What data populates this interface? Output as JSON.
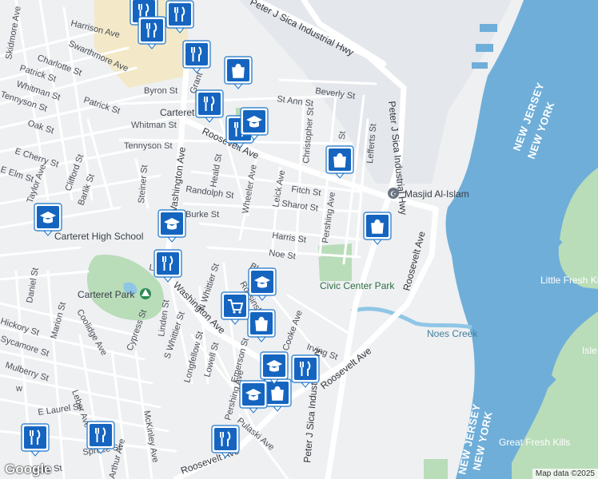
{
  "attribution": "Map data ©2025",
  "logo_text": "Google",
  "colors": {
    "water": "#6faed8",
    "park": "#b9dcb9",
    "road": "#ffffff",
    "land": "#eef0f2",
    "industrial": "#e4e7ec",
    "pin_blue": "#1565c0"
  },
  "places": {
    "city": "Carteret",
    "mosque": "Masjid Al-Islam",
    "high_school": "Carteret High School",
    "park": "Carteret Park",
    "civic_park": "Civic Center Park",
    "creek": "Noes Creek",
    "little_fresh_kills": "Little Fresh Kills",
    "isle_meadow": "Isle Meadow",
    "great_fresh_kills": "Great Fresh Kills"
  },
  "borders": {
    "nj": "NEW JERSEY",
    "ny": "NEW YORK"
  },
  "highways": {
    "sica_top": "Peter J Sica Industrial Hwy",
    "sica_vertical": "Peter J Sica Industrial Hwy",
    "sica_bottom": "Peter J Sica Industrial Hwy",
    "roosevelt_main": "Roosevelt Ave",
    "roosevelt_east": "Roosevelt Ave",
    "roosevelt_lower": "Roosevelt Ave",
    "roosevelt_bottom": "Roosevelt Ave",
    "washington": "Washington Ave",
    "washington_lower": "Washington Ave"
  },
  "streets": {
    "harrison": "Harrison Ave",
    "swarthmore": "Swarthmore Ave",
    "skidmore": "Skidmore Ave",
    "charlotte": "Charlotte St",
    "patrick": "Patrick St",
    "whitman": "Whitman St",
    "tennyson": "Tennyson St",
    "patrick2": "Patrick St",
    "byron": "Byron St",
    "oak": "Oak St",
    "grant": "Grant",
    "whitman2": "Whitman St",
    "tennyson2": "Tennyson St",
    "e_cherry": "E Cherry St",
    "e_elm": "E Elm St",
    "taylor": "Taylor Ave",
    "clifford": "Clifford St",
    "barlik": "Barlik St",
    "steiner": "Steiner St",
    "heald": "Heald St",
    "randolph": "Randolph St",
    "burke": "Burke St",
    "wheeler": "Wheeler Ave",
    "leick": "Leick Ave",
    "fitch": "Fitch St",
    "sharot": "Sharot St",
    "harris": "Harris St",
    "noe": "Noe St",
    "pershing": "Pershing Ave",
    "christopher": "Christopher St",
    "st_ann": "St Ann St",
    "beverly": "Beverly St",
    "lefferts": "Lefferts St",
    "blair": "Blair",
    "rossinski": "Rossinski St",
    "daniel": "Daniel St",
    "hickory": "Hickory St",
    "sycamore": "Sycamore St",
    "mulberry": "Mulberry St",
    "marion": "Marion St",
    "coolidge": "Coolidge Ave",
    "cypress": "Cypress St",
    "linden": "Linden St",
    "n_whittier": "N Whittier St",
    "s_whittier": "S Whittier St",
    "longfellow": "Longfellow St",
    "lowell": "Lowell St",
    "emerson": "Emerson St",
    "pershing2": "Pershing Ave",
    "cooke": "Cooke Ave",
    "irving": "Irving St",
    "leber": "Leber Ave",
    "e_laurel": "E Laurel St",
    "spruce": "Spruce St",
    "holly": "Holly St",
    "arthur": "Arthur Ave",
    "mckinley": "McKinley Ave",
    "pulaski": "Pulaski Ave",
    "locust": "Locust",
    "ave_c": "C",
    "st_w": "St",
    "ave_w": "w"
  },
  "markers": [
    {
      "type": "restaurant",
      "icon": "restaurant-icon"
    },
    {
      "type": "restaurant",
      "icon": "restaurant-icon"
    },
    {
      "type": "restaurant",
      "icon": "restaurant-icon"
    },
    {
      "type": "restaurant",
      "icon": "restaurant-icon"
    },
    {
      "type": "restaurant",
      "icon": "restaurant-icon"
    },
    {
      "type": "restaurant",
      "icon": "restaurant-icon"
    },
    {
      "type": "restaurant",
      "icon": "restaurant-icon"
    },
    {
      "type": "restaurant",
      "icon": "restaurant-icon"
    },
    {
      "type": "restaurant",
      "icon": "restaurant-icon"
    },
    {
      "type": "restaurant",
      "icon": "restaurant-icon"
    },
    {
      "type": "restaurant",
      "icon": "restaurant-icon"
    },
    {
      "type": "shopping",
      "icon": "shopping-bag-icon"
    },
    {
      "type": "shopping",
      "icon": "shopping-bag-icon"
    },
    {
      "type": "shopping",
      "icon": "shopping-bag-icon"
    },
    {
      "type": "shopping",
      "icon": "shopping-bag-icon"
    },
    {
      "type": "shopping",
      "icon": "shopping-bag-icon"
    },
    {
      "type": "grocery",
      "icon": "shopping-cart-icon"
    },
    {
      "type": "school",
      "icon": "school-icon"
    },
    {
      "type": "school",
      "icon": "school-icon"
    },
    {
      "type": "school",
      "icon": "school-icon"
    },
    {
      "type": "school",
      "icon": "school-icon"
    },
    {
      "type": "school",
      "icon": "school-icon"
    },
    {
      "type": "school",
      "icon": "school-icon"
    }
  ]
}
